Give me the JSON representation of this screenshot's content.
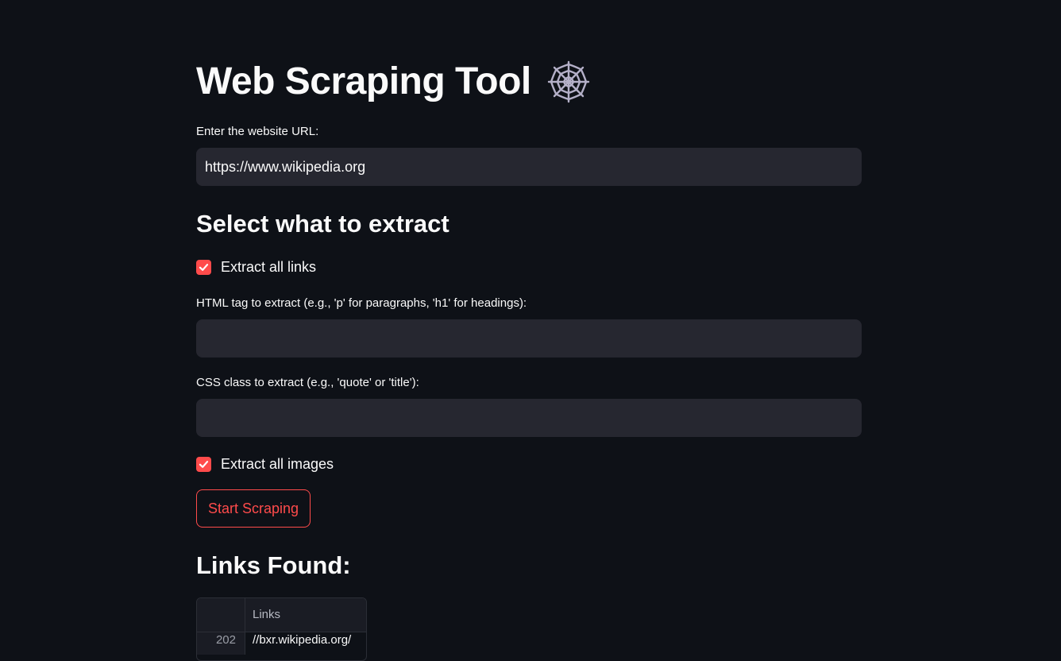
{
  "header": {
    "title": "Web Scraping Tool"
  },
  "url_field": {
    "label": "Enter the website URL:",
    "value": "https://www.wikipedia.org"
  },
  "section": {
    "heading": "Select what to extract"
  },
  "extract_links": {
    "label": "Extract all links",
    "checked": true
  },
  "tag_field": {
    "label": "HTML tag to extract (e.g., 'p' for paragraphs, 'h1' for headings):",
    "value": ""
  },
  "class_field": {
    "label": "CSS class to extract (e.g., 'quote' or 'title'):",
    "value": ""
  },
  "extract_images": {
    "label": "Extract all images",
    "checked": true
  },
  "actions": {
    "start_label": "Start Scraping"
  },
  "results": {
    "heading": "Links Found:",
    "table": {
      "column": "Links",
      "rows": [
        {
          "index": "202",
          "value": "//bxr.wikipedia.org/"
        }
      ]
    }
  },
  "colors": {
    "background": "#0e1117",
    "input": "#262730",
    "accent": "#ff4b4b",
    "text": "#fafafa"
  },
  "icons": {
    "title_icon": "spider-web-icon",
    "check_icon": "checkmark-icon"
  }
}
